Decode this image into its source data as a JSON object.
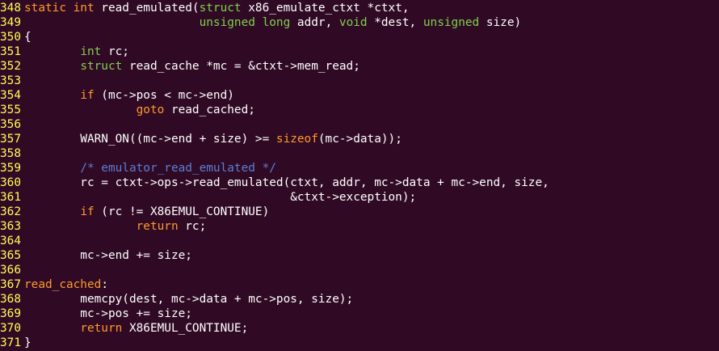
{
  "editor": {
    "colors": {
      "background": "#300a24",
      "default": "#ffffff",
      "line_number": "#ffff55",
      "keyword": "#ff9a2a",
      "type": "#7ed14e",
      "comment": "#5c7ed7"
    },
    "lines": [
      {
        "num": "348",
        "segs": [
          [
            "static int",
            "keyword"
          ],
          [
            " read_emulated(",
            ""
          ],
          [
            "struct",
            "type"
          ],
          [
            " x86_emulate_ctxt *ctxt,",
            ""
          ]
        ]
      },
      {
        "num": "349",
        "segs": [
          [
            "                         ",
            ""
          ],
          [
            "unsigned long",
            "type"
          ],
          [
            " addr, ",
            ""
          ],
          [
            "void",
            "type"
          ],
          [
            " *dest, ",
            ""
          ],
          [
            "unsigned",
            "type"
          ],
          [
            " size)",
            ""
          ]
        ]
      },
      {
        "num": "350",
        "segs": [
          [
            "{",
            ""
          ]
        ]
      },
      {
        "num": "351",
        "segs": [
          [
            "        ",
            ""
          ],
          [
            "int",
            "type"
          ],
          [
            " rc;",
            ""
          ]
        ]
      },
      {
        "num": "352",
        "segs": [
          [
            "        ",
            ""
          ],
          [
            "struct",
            "type"
          ],
          [
            " read_cache *mc = &ctxt->mem_read;",
            ""
          ]
        ]
      },
      {
        "num": "353",
        "segs": []
      },
      {
        "num": "354",
        "segs": [
          [
            "        ",
            ""
          ],
          [
            "if",
            "keyword"
          ],
          [
            " (mc->pos < mc->end)",
            ""
          ]
        ]
      },
      {
        "num": "355",
        "segs": [
          [
            "                ",
            ""
          ],
          [
            "goto",
            "keyword"
          ],
          [
            " read_cached;",
            ""
          ]
        ]
      },
      {
        "num": "356",
        "segs": []
      },
      {
        "num": "357",
        "segs": [
          [
            "        WARN_ON((mc->end + size) >= ",
            ""
          ],
          [
            "sizeof",
            "keyword"
          ],
          [
            "(mc->data));",
            ""
          ]
        ]
      },
      {
        "num": "358",
        "segs": []
      },
      {
        "num": "359",
        "segs": [
          [
            "        ",
            ""
          ],
          [
            "/* emulator_read_emulated */",
            "comment"
          ]
        ]
      },
      {
        "num": "360",
        "segs": [
          [
            "        rc = ctxt->ops->read_emulated(ctxt, addr, mc->data + mc->end, size,",
            ""
          ]
        ]
      },
      {
        "num": "361",
        "segs": [
          [
            "                                      &ctxt->exception);",
            ""
          ]
        ]
      },
      {
        "num": "362",
        "segs": [
          [
            "        ",
            ""
          ],
          [
            "if",
            "keyword"
          ],
          [
            " (rc != X86EMUL_CONTINUE)",
            ""
          ]
        ]
      },
      {
        "num": "363",
        "segs": [
          [
            "                ",
            ""
          ],
          [
            "return",
            "keyword"
          ],
          [
            " rc;",
            ""
          ]
        ]
      },
      {
        "num": "364",
        "segs": []
      },
      {
        "num": "365",
        "segs": [
          [
            "        mc->end += size;",
            ""
          ]
        ]
      },
      {
        "num": "366",
        "segs": []
      },
      {
        "num": "367",
        "segs": [
          [
            "read_cached",
            "keyword"
          ],
          [
            ":",
            ""
          ]
        ]
      },
      {
        "num": "368",
        "segs": [
          [
            "        memcpy(dest, mc->data + mc->pos, size);",
            ""
          ]
        ]
      },
      {
        "num": "369",
        "segs": [
          [
            "        mc->pos += size;",
            ""
          ]
        ]
      },
      {
        "num": "370",
        "segs": [
          [
            "        ",
            ""
          ],
          [
            "return",
            "keyword"
          ],
          [
            " X86EMUL_CONTINUE;",
            ""
          ]
        ]
      },
      {
        "num": "371",
        "segs": [
          [
            "}",
            ""
          ]
        ]
      }
    ]
  }
}
